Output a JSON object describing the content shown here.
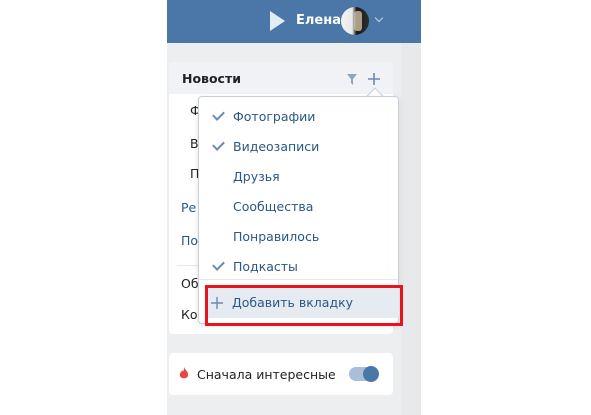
{
  "header": {
    "user_name": "Елена",
    "icons": [
      "play-icon",
      "avatar",
      "chevron-down-icon"
    ]
  },
  "panel": {
    "title": "Новости",
    "header_icons": [
      "filter-icon",
      "plus-icon"
    ],
    "peek_items": [
      {
        "text": "Ф"
      },
      {
        "text": "В"
      },
      {
        "text": "П"
      },
      {
        "text": "Ре"
      },
      {
        "text": "По"
      },
      {
        "text": "Об"
      },
      {
        "text": "Ко"
      }
    ]
  },
  "dropdown": {
    "items": [
      {
        "label": "Фотографии",
        "checked": true
      },
      {
        "label": "Видеозаписи",
        "checked": true
      },
      {
        "label": "Друзья",
        "checked": false
      },
      {
        "label": "Сообщества",
        "checked": false
      },
      {
        "label": "Понравилось",
        "checked": false
      },
      {
        "label": "Подкасты",
        "checked": true
      }
    ],
    "add_tab_label": "Добавить вкладку"
  },
  "bottom": {
    "label": "Сначала интересные",
    "toggle_on": true
  },
  "colors": {
    "header_blue": "#4a76a8",
    "link_blue": "#2a5885",
    "highlight_red": "#e8141c"
  }
}
